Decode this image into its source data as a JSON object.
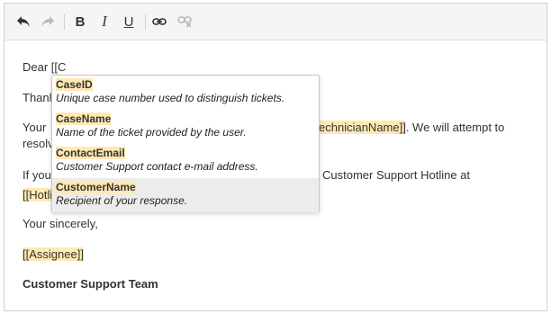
{
  "toolbar": {
    "undo_icon": "undo-icon",
    "redo_icon": "redo-icon",
    "bold_label": "B",
    "italic_label": "I",
    "underline_label": "U",
    "link_icon": "link-icon",
    "unlink_icon": "unlink-icon"
  },
  "body": {
    "greeting_prefix": "Dear ",
    "greeting_typed": "[[C",
    "thanks_visible": "Thanl",
    "line2_start": "Your ",
    "line2_placeholder_tail": "echnicianName]]",
    "line2_end": ". We will attempt to",
    "line3_start": "resolv",
    "line4_start": "If you",
    "line4_end": "Customer Support Hotline at",
    "line5_placeholder": "[[Hotli",
    "closing": "Your sincerely,",
    "assignee_placeholder": "[[Assignee]]",
    "signature": "Customer Support Team"
  },
  "autocomplete": {
    "items": [
      {
        "name": "CaseID",
        "description": "Unique case number used to distinguish tickets."
      },
      {
        "name": "CaseName",
        "description": "Name of the ticket provided by the user."
      },
      {
        "name": "ContactEmail",
        "description": "Customer Support contact e-mail address."
      },
      {
        "name": "CustomerName",
        "description": "Recipient of your response."
      }
    ],
    "selected_index": 3
  },
  "colors": {
    "placeholder_highlight": "#ffe9b3",
    "selected_item_bg": "#ececec",
    "toolbar_bg": "#f5f5f5"
  }
}
